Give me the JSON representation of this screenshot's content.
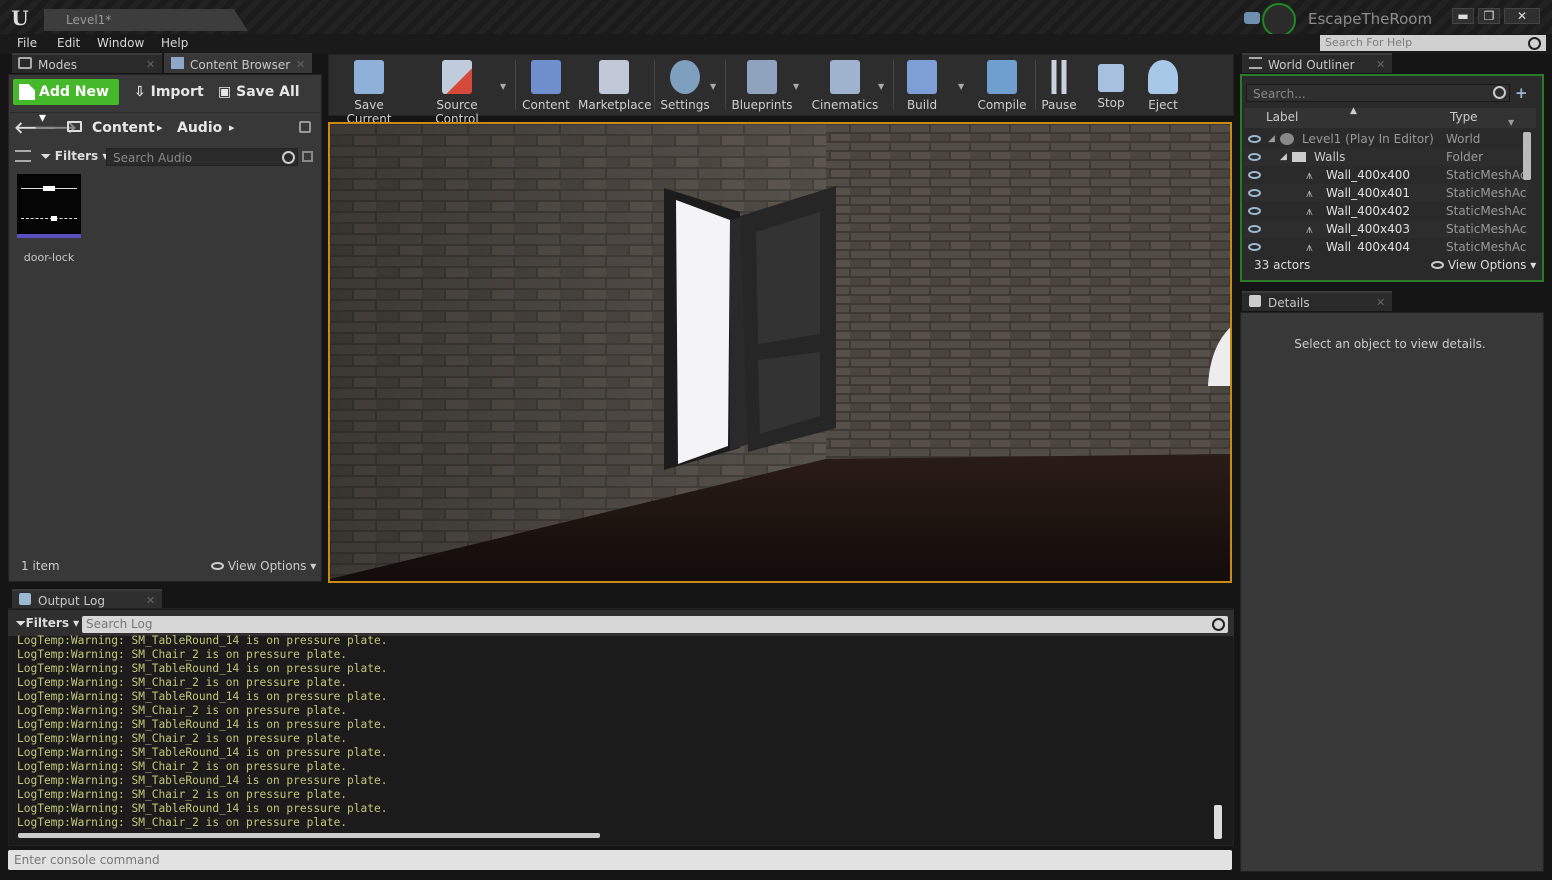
{
  "titlebar": {
    "doc_tab": "Level1*",
    "project_name": "EscapeTheRoom",
    "min": "▬",
    "max": "❐",
    "close": "✕"
  },
  "menu": {
    "items": [
      "File",
      "Edit",
      "Window",
      "Help"
    ],
    "search_placeholder": "Search For Help"
  },
  "left_tabs": {
    "modes": "Modes",
    "content_browser": "Content Browser"
  },
  "content_browser": {
    "add_new": "Add New",
    "import": "Import",
    "save_all": "Save All",
    "breadcrumb": [
      "Content",
      "Audio"
    ],
    "filters": "Filters",
    "search_placeholder": "Search Audio",
    "asset_label": "door-lock",
    "item_count": "1 item",
    "view_options": "View Options"
  },
  "toolbar": {
    "buttons": [
      {
        "label": "Save Current",
        "color": "#8fb0d8"
      },
      {
        "label": "Source Control",
        "color": "#d64a3a"
      },
      {
        "label": "Content",
        "color": "#6f8fcf"
      },
      {
        "label": "Marketplace",
        "color": "#c0c8d8"
      },
      {
        "label": "Settings",
        "color": "#7f9fbf"
      },
      {
        "label": "Blueprints",
        "color": "#8fa3bf"
      },
      {
        "label": "Cinematics",
        "color": "#9fb3cf"
      },
      {
        "label": "Build",
        "color": "#7d9fd6"
      },
      {
        "label": "Compile",
        "color": "#6f9fcf"
      },
      {
        "label": "Pause",
        "color": "#c8d2e0"
      },
      {
        "label": "Stop",
        "color": "#a8c0e0"
      },
      {
        "label": "Eject",
        "color": "#a8c8e8"
      }
    ]
  },
  "outliner": {
    "tab": "World Outliner",
    "search_placeholder": "Search...",
    "col_label": "Label",
    "col_type": "Type",
    "rows": [
      {
        "label": "Level1 (Play In Editor)",
        "type": "World"
      },
      {
        "label": "Walls",
        "type": "Folder"
      },
      {
        "label": "Wall_400x400",
        "type": "StaticMeshAc"
      },
      {
        "label": "Wall_400x401",
        "type": "StaticMeshAc"
      },
      {
        "label": "Wall_400x402",
        "type": "StaticMeshAc"
      },
      {
        "label": "Wall_400x403",
        "type": "StaticMeshAc"
      },
      {
        "label": "Wall_400x404",
        "type": "StaticMeshAc"
      }
    ],
    "actor_count": "33 actors",
    "view_options": "View Options"
  },
  "details": {
    "tab": "Details",
    "empty_message": "Select an object to view details."
  },
  "output_log": {
    "tab": "Output Log",
    "filters": "Filters",
    "search_placeholder": "Search Log",
    "lines": [
      "LogTemp:Warning: SM_TableRound_14 is on pressure plate.",
      "LogTemp:Warning: SM_Chair_2 is on pressure plate.",
      "LogTemp:Warning: SM_TableRound_14 is on pressure plate.",
      "LogTemp:Warning: SM_Chair_2 is on pressure plate.",
      "LogTemp:Warning: SM_TableRound_14 is on pressure plate.",
      "LogTemp:Warning: SM_Chair_2 is on pressure plate.",
      "LogTemp:Warning: SM_TableRound_14 is on pressure plate.",
      "LogTemp:Warning: SM_Chair_2 is on pressure plate.",
      "LogTemp:Warning: SM_TableRound_14 is on pressure plate.",
      "LogTemp:Warning: SM_Chair_2 is on pressure plate.",
      "LogTemp:Warning: SM_TableRound_14 is on pressure plate.",
      "LogTemp:Warning: SM_Chair_2 is on pressure plate.",
      "LogTemp:Warning: SM_TableRound_14 is on pressure plate.",
      "LogTemp:Warning: SM_Chair_2 is on pressure plate."
    ],
    "console_placeholder": "Enter console command"
  }
}
